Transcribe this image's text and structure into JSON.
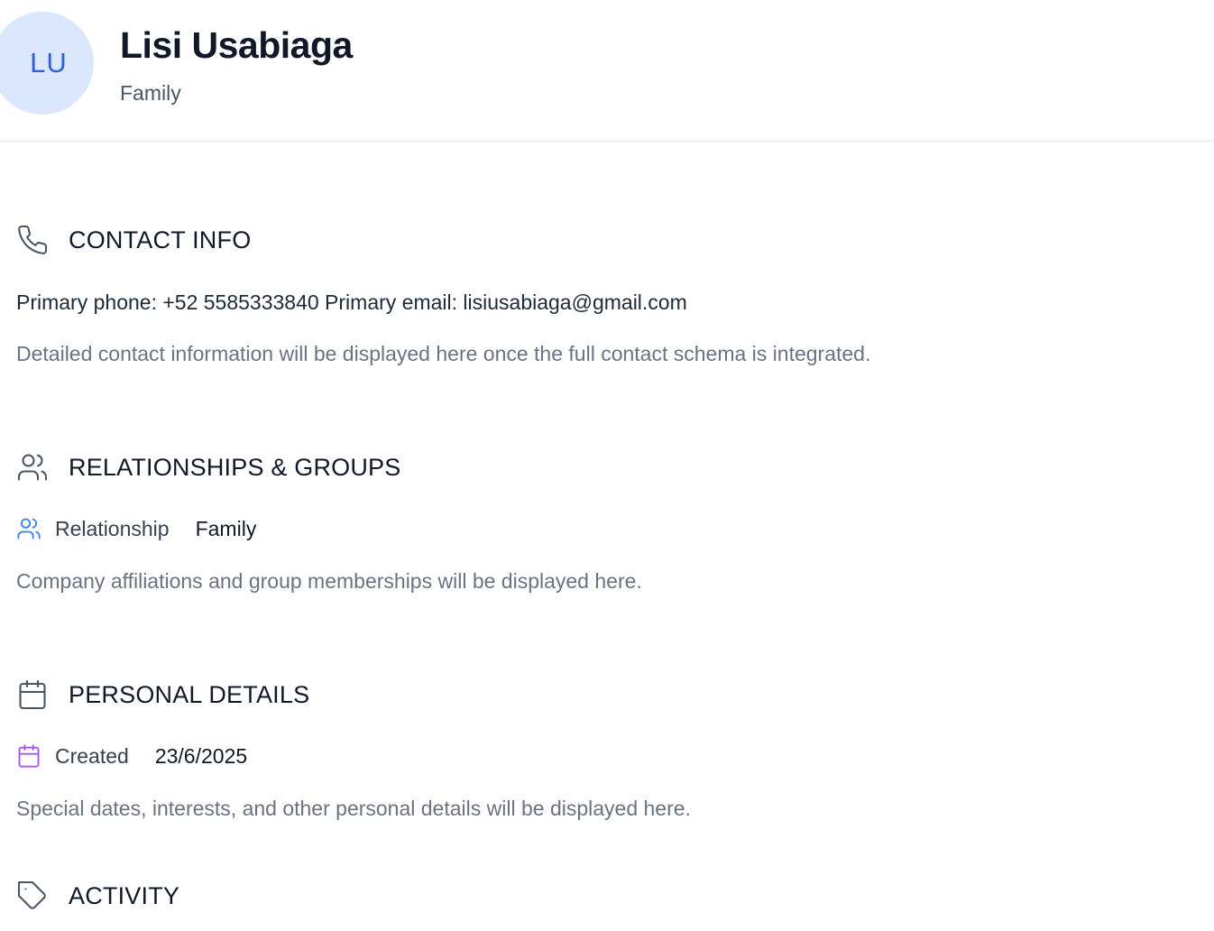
{
  "contact": {
    "initials": "LU",
    "name": "Lisi Usabiaga",
    "subtitle": "Family"
  },
  "sections": {
    "contact_info": {
      "title": "CONTACT INFO",
      "icon": "phone-icon",
      "primary_line": "Primary phone: +52 5585333840 Primary email: lisiusabiaga@gmail.com",
      "note": "Detailed contact information will be displayed here once the full contact schema is integrated."
    },
    "relationships": {
      "title": "RELATIONSHIPS & GROUPS",
      "icon": "users-icon",
      "field_label": "Relationship",
      "field_value": "Family",
      "field_icon_color": "#3b82f6",
      "note": "Company affiliations and group memberships will be displayed here."
    },
    "personal_details": {
      "title": "PERSONAL DETAILS",
      "icon": "calendar-icon",
      "field_label": "Created",
      "field_value": "23/6/2025",
      "field_icon_color": "#a855f7",
      "note": "Special dates, interests, and other personal details will be displayed here."
    },
    "activity": {
      "title": "ACTIVITY",
      "icon": "tag-icon"
    }
  },
  "colors": {
    "avatar_bg": "#dbe7fd",
    "avatar_text": "#2e62d6",
    "heading": "#111827",
    "muted": "#6b7280",
    "icon_gray": "#4b5563"
  }
}
